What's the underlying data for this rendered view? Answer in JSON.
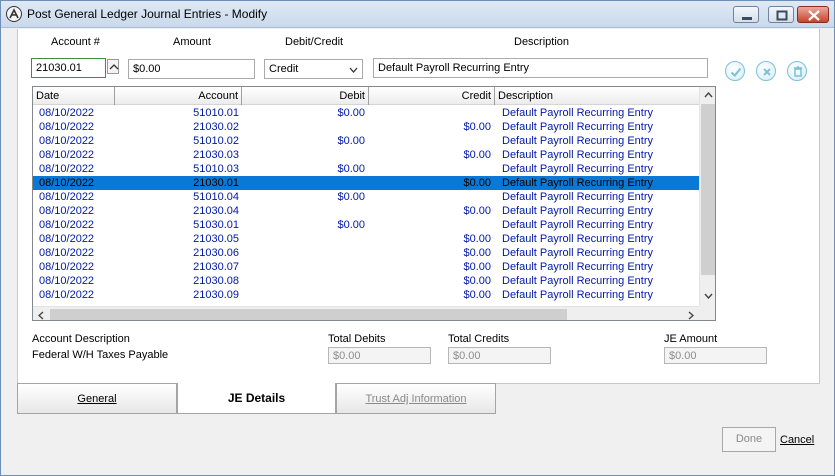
{
  "window": {
    "title": "Post General Ledger Journal Entries - Modify"
  },
  "header": {
    "labels": {
      "account": "Account #",
      "amount": "Amount",
      "debit_credit": "Debit/Credit",
      "description": "Description"
    },
    "account_value": "21030.01",
    "amount_value": "$0.00",
    "debit_credit_value": "Credit",
    "description_value": "Default Payroll Recurring Entry",
    "icons": [
      "check-icon",
      "cancel-icon",
      "trash-icon"
    ]
  },
  "grid": {
    "columns": [
      "Date",
      "Account",
      "Debit",
      "Credit",
      "Description"
    ],
    "rows": [
      {
        "date": "08/10/2022",
        "account": "51010.01",
        "debit": "$0.00",
        "credit": "",
        "description": "Default Payroll Recurring Entry"
      },
      {
        "date": "08/10/2022",
        "account": "21030.02",
        "debit": "",
        "credit": "$0.00",
        "description": "Default Payroll Recurring Entry"
      },
      {
        "date": "08/10/2022",
        "account": "51010.02",
        "debit": "$0.00",
        "credit": "",
        "description": "Default Payroll Recurring Entry"
      },
      {
        "date": "08/10/2022",
        "account": "21030.03",
        "debit": "",
        "credit": "$0.00",
        "description": "Default Payroll Recurring Entry"
      },
      {
        "date": "08/10/2022",
        "account": "51010.03",
        "debit": "$0.00",
        "credit": "",
        "description": "Default Payroll Recurring Entry"
      },
      {
        "date": "08/10/2022",
        "account": "21030.01",
        "debit": "",
        "credit": "$0.00",
        "description": "Default Payroll Recurring Entry",
        "selected": true
      },
      {
        "date": "08/10/2022",
        "account": "51010.04",
        "debit": "$0.00",
        "credit": "",
        "description": "Default Payroll Recurring Entry"
      },
      {
        "date": "08/10/2022",
        "account": "21030.04",
        "debit": "",
        "credit": "$0.00",
        "description": "Default Payroll Recurring Entry"
      },
      {
        "date": "08/10/2022",
        "account": "51030.01",
        "debit": "$0.00",
        "credit": "",
        "description": "Default Payroll Recurring Entry"
      },
      {
        "date": "08/10/2022",
        "account": "21030.05",
        "debit": "",
        "credit": "$0.00",
        "description": "Default Payroll Recurring Entry"
      },
      {
        "date": "08/10/2022",
        "account": "21030.06",
        "debit": "",
        "credit": "$0.00",
        "description": "Default Payroll Recurring Entry"
      },
      {
        "date": "08/10/2022",
        "account": "21030.07",
        "debit": "",
        "credit": "$0.00",
        "description": "Default Payroll Recurring Entry"
      },
      {
        "date": "08/10/2022",
        "account": "21030.08",
        "debit": "",
        "credit": "$0.00",
        "description": "Default Payroll Recurring Entry"
      },
      {
        "date": "08/10/2022",
        "account": "21030.09",
        "debit": "",
        "credit": "$0.00",
        "description": "Default Payroll Recurring Entry"
      }
    ]
  },
  "summary": {
    "account_description_label": "Account Description",
    "account_description_value": "Federal W/H Taxes Payable",
    "total_debits_label": "Total Debits",
    "total_debits_value": "$0.00",
    "total_credits_label": "Total Credits",
    "total_credits_value": "$0.00",
    "je_amount_label": "JE Amount",
    "je_amount_value": "$0.00"
  },
  "tabs": [
    {
      "label": "General",
      "state": "normal"
    },
    {
      "label": "JE Details",
      "state": "active"
    },
    {
      "label": "Trust Adj Information",
      "state": "disabled"
    }
  ],
  "footer": {
    "done_label": "Done",
    "cancel_label": "Cancel"
  },
  "colors": {
    "row_text": "#0018a8",
    "selection": "#0a78d7",
    "title_bar": "#c9d9ec"
  }
}
